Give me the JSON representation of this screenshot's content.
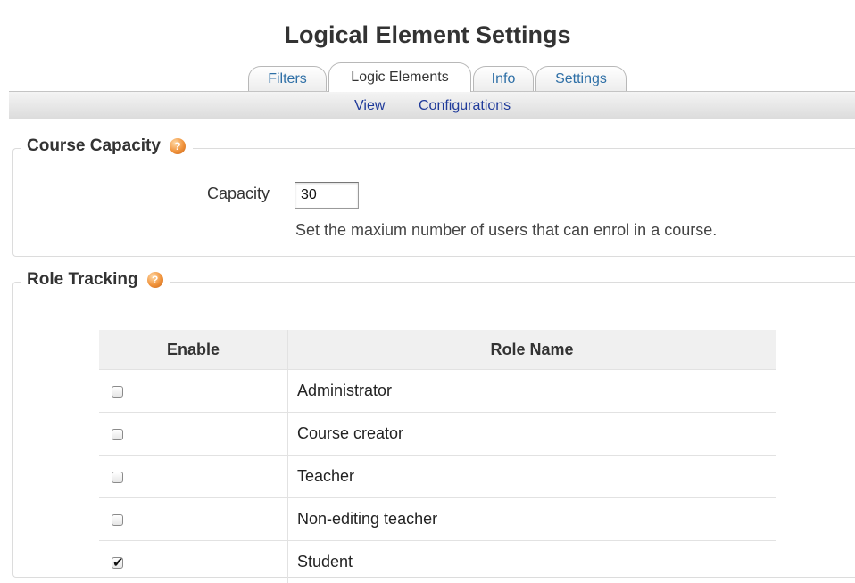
{
  "page": {
    "title": "Logical Element Settings"
  },
  "tabs": [
    {
      "label": "Filters",
      "active": false
    },
    {
      "label": "Logic Elements",
      "active": true
    },
    {
      "label": "Info",
      "active": false
    },
    {
      "label": "Settings",
      "active": false
    }
  ],
  "subnav": {
    "view": "View",
    "configurations": "Configurations"
  },
  "course_capacity": {
    "legend": "Course Capacity",
    "field_label": "Capacity",
    "value": "30",
    "description": "Set the maxium number of users that can enrol in a course."
  },
  "role_tracking": {
    "legend": "Role Tracking",
    "headers": {
      "enable": "Enable",
      "role_name": "Role Name"
    },
    "rows": [
      {
        "name": "Administrator",
        "enabled": false
      },
      {
        "name": "Course creator",
        "enabled": false
      },
      {
        "name": "Teacher",
        "enabled": false
      },
      {
        "name": "Non-editing teacher",
        "enabled": false
      },
      {
        "name": "Student",
        "enabled": true
      }
    ]
  },
  "icons": {
    "help": "help-icon"
  },
  "colors": {
    "link": "#1f3a9a",
    "tab_link": "#2e6fa6",
    "help_icon": "#f0923a"
  }
}
